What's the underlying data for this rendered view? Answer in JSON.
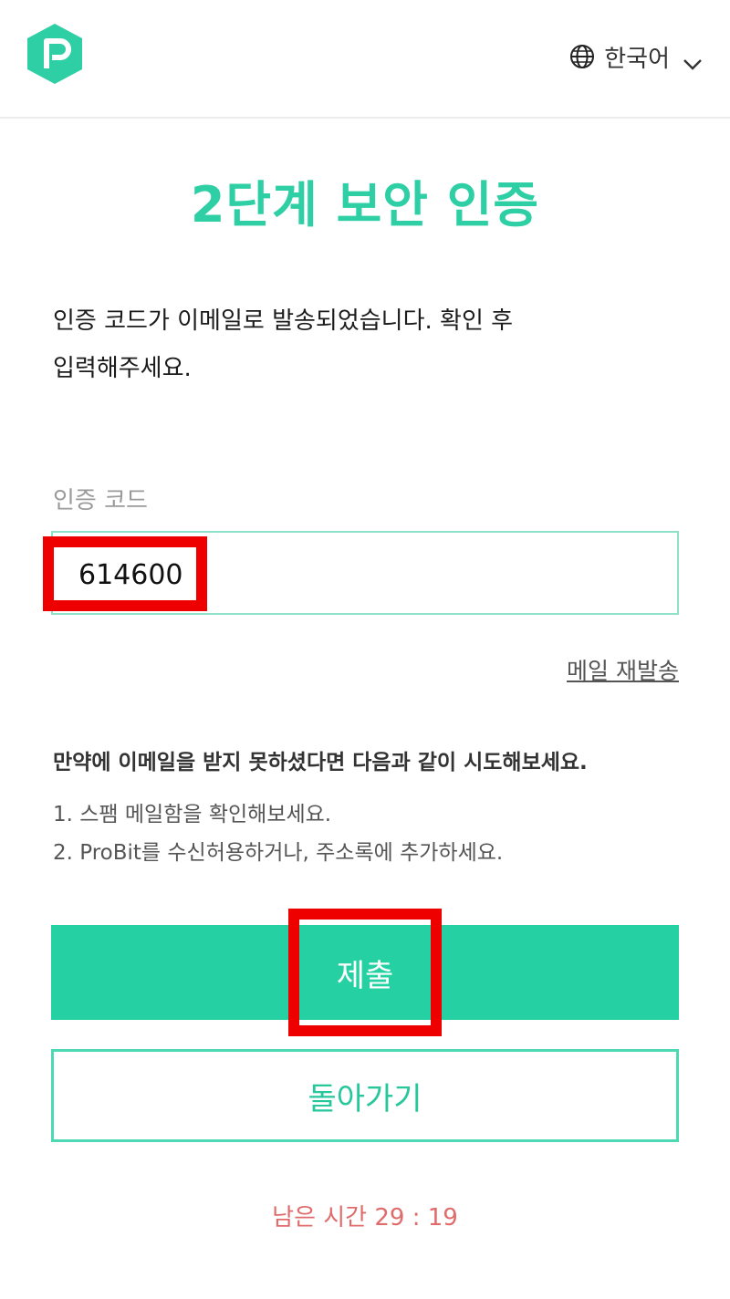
{
  "header": {
    "language": "한국어",
    "icons": {
      "logo": "probit-logo",
      "globe": "globe-icon",
      "chevron": "chevron-down-icon"
    },
    "colors": {
      "brand": "#2ecfa4"
    }
  },
  "main": {
    "title": "2단계 보안 인증",
    "description_line1": "인증 코드가 이메일로 발송되었습니다. 확인 후",
    "description_line2": "입력해주세요.",
    "code_label": "인증 코드",
    "code_value": "614600",
    "resend_link": "메일 재발송",
    "help_title": "만약에 이메일을 받지 못하셨다면 다음과 같이 시도해보세요.",
    "help_items": [
      "1. 스팸 메일함을 확인해보세요.",
      "2. ProBit를 수신허용하거나, 주소록에 추가하세요."
    ],
    "submit_label": "제출",
    "back_label": "돌아가기",
    "timer": "남은 시간 29 : 19"
  },
  "colors": {
    "accent": "#25d1a3",
    "timer": "#e06b6b",
    "highlight": "#ee0000"
  }
}
